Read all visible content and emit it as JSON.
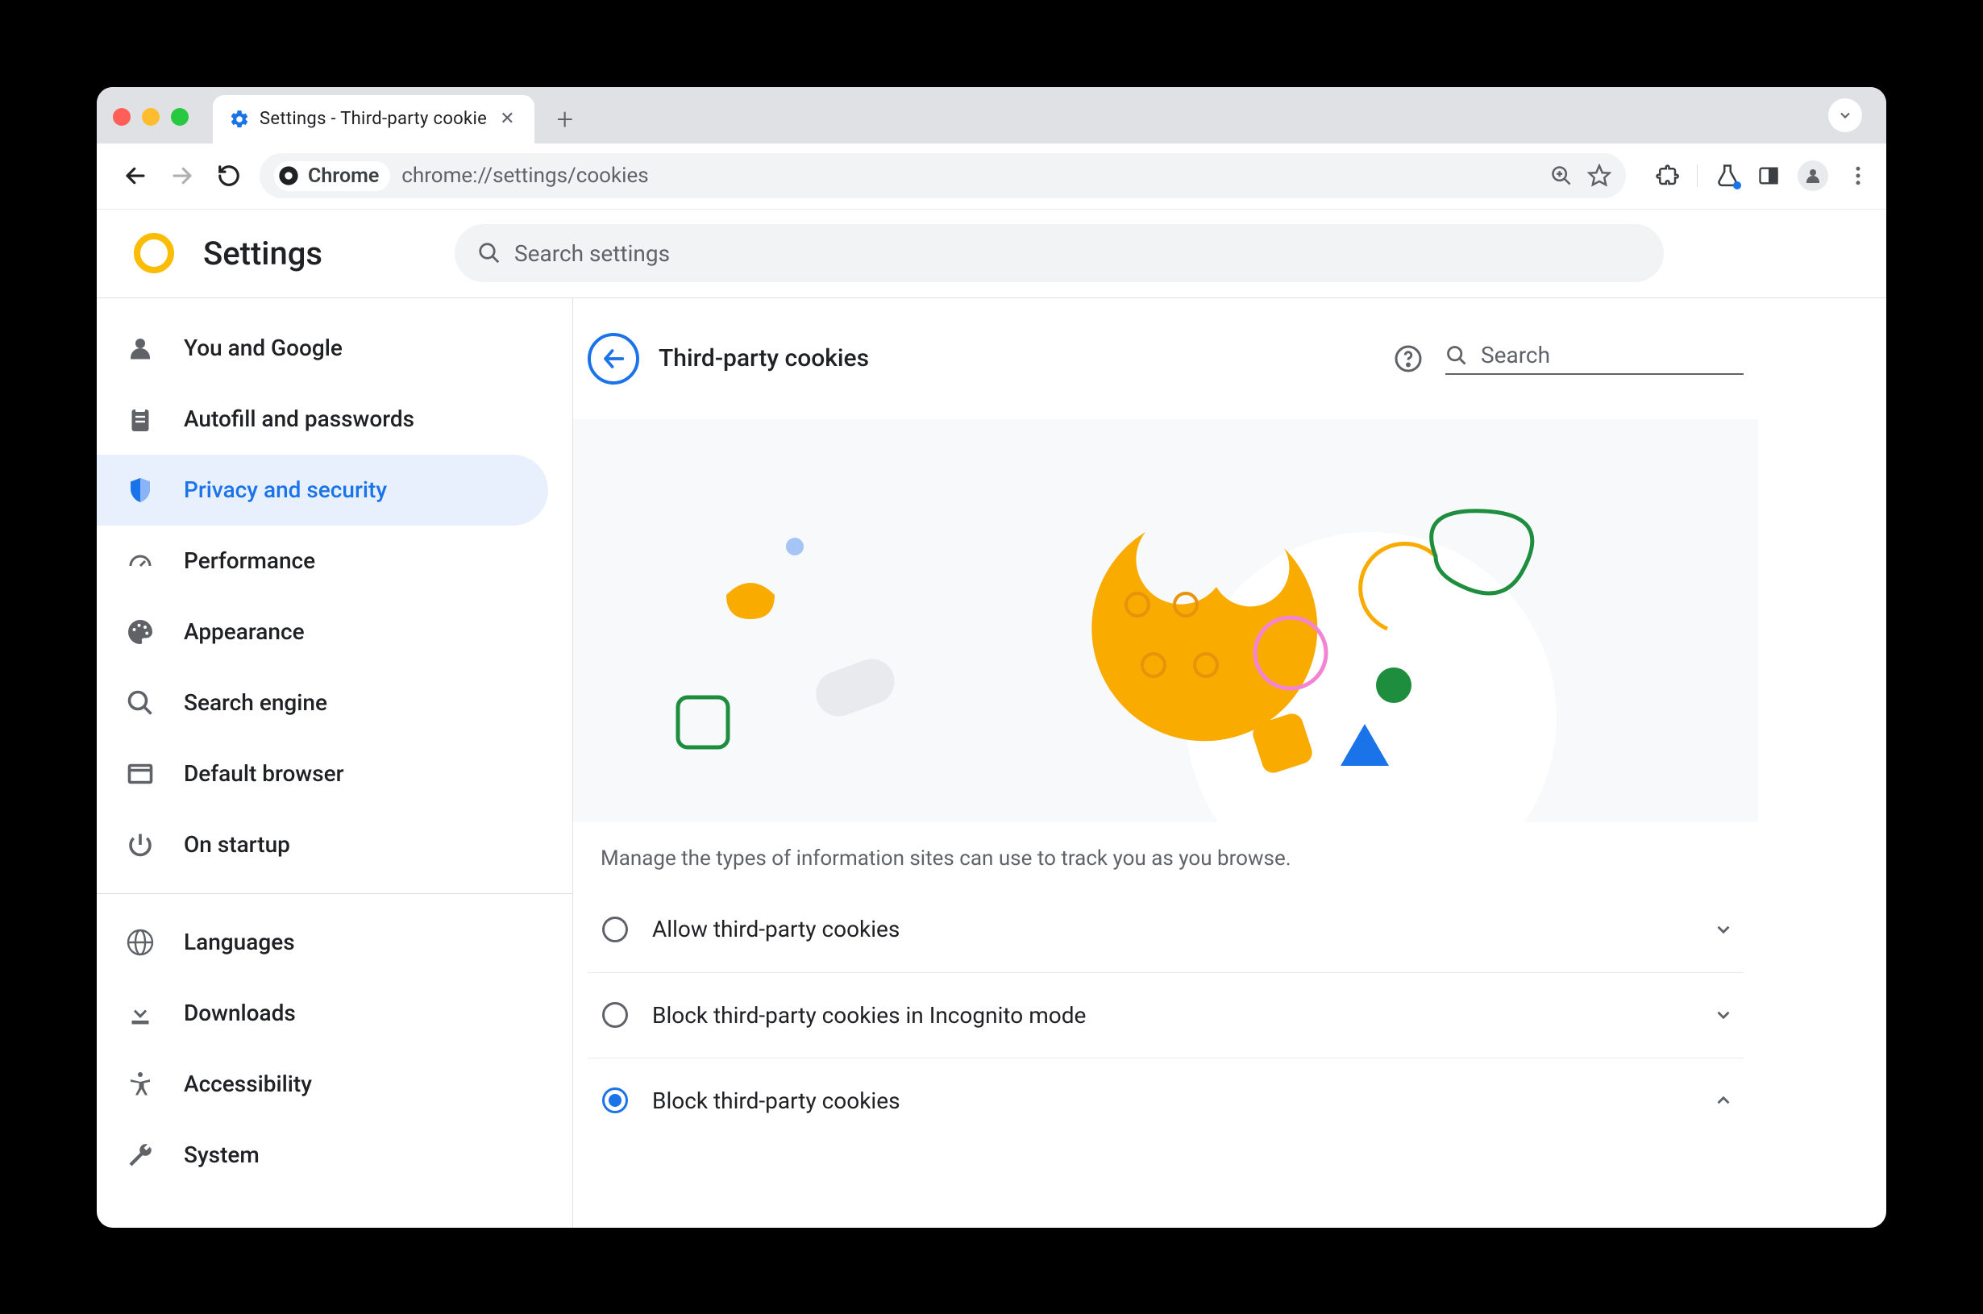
{
  "tab": {
    "title": "Settings - Third-party cookie"
  },
  "omnibox": {
    "host_label": "Chrome",
    "url": "chrome://settings/cookies"
  },
  "app": {
    "title": "Settings",
    "search_placeholder": "Search settings"
  },
  "sidebar": {
    "items": [
      {
        "label": "You and Google"
      },
      {
        "label": "Autofill and passwords"
      },
      {
        "label": "Privacy and security"
      },
      {
        "label": "Performance"
      },
      {
        "label": "Appearance"
      },
      {
        "label": "Search engine"
      },
      {
        "label": "Default browser"
      },
      {
        "label": "On startup"
      }
    ],
    "items2": [
      {
        "label": "Languages"
      },
      {
        "label": "Downloads"
      },
      {
        "label": "Accessibility"
      },
      {
        "label": "System"
      }
    ]
  },
  "page": {
    "title": "Third-party cookies",
    "search_placeholder": "Search",
    "description": "Manage the types of information sites can use to track you as you browse.",
    "options": [
      {
        "label": "Allow third-party cookies",
        "selected": false,
        "expanded": false
      },
      {
        "label": "Block third-party cookies in Incognito mode",
        "selected": false,
        "expanded": false
      },
      {
        "label": "Block third-party cookies",
        "selected": true,
        "expanded": true
      }
    ]
  }
}
